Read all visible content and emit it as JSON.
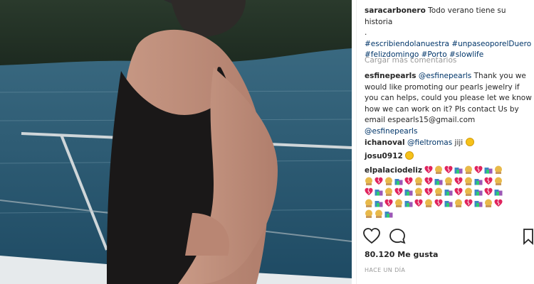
{
  "post": {
    "author": "saracarbonero",
    "caption_text": "Todo verano tiene su historia",
    "caption_dot": ".",
    "hashtags_line1": "#escribiendolanuestra #unpaseoporelDuero",
    "hashtags_line2": "#felizdomingo #Porto #slowlife",
    "load_more": "Cargar más comentarios"
  },
  "comments": [
    {
      "user": "esfinepearls",
      "lines": [
        {
          "mention": "@esfinepearls",
          "text": " Thank you we"
        },
        {
          "text": "would like promoting our pearls jewelry if"
        },
        {
          "text": "you can helps, could you please let we know"
        },
        {
          "text": "how we can work on it? Pls contact Us by"
        },
        {
          "text": "email espearls15@gmail.com"
        },
        {
          "mention": "@esfinepearls"
        }
      ]
    },
    {
      "user": "ichanoval",
      "mention": "@fieltromas",
      "text": " jiji"
    },
    {
      "user": "josu0912",
      "text": ""
    },
    {
      "user": "elpalaciodeliz",
      "text": ""
    }
  ],
  "likes": "80.120 Me gusta",
  "timestamp": "HACE UN DÍA",
  "colors": {
    "link": "#003569",
    "muted": "#999999",
    "text": "#262626"
  }
}
